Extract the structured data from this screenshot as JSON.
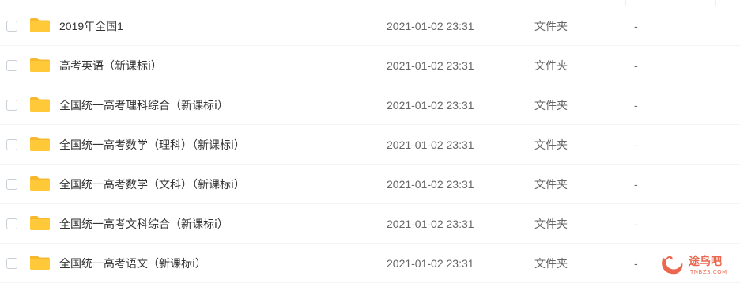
{
  "files": [
    {
      "name": "2019年全国1",
      "date": "2021-01-02 23:31",
      "type": "文件夹",
      "size": "-"
    },
    {
      "name": "高考英语（新课标ⅰ）",
      "date": "2021-01-02 23:31",
      "type": "文件夹",
      "size": "-"
    },
    {
      "name": "全国统一高考理科综合（新课标ⅰ）",
      "date": "2021-01-02 23:31",
      "type": "文件夹",
      "size": "-"
    },
    {
      "name": "全国统一高考数学（理科）（新课标ⅰ）",
      "date": "2021-01-02 23:31",
      "type": "文件夹",
      "size": "-"
    },
    {
      "name": "全国统一高考数学（文科）（新课标ⅰ）",
      "date": "2021-01-02 23:31",
      "type": "文件夹",
      "size": "-"
    },
    {
      "name": "全国统一高考文科综合（新课标ⅰ）",
      "date": "2021-01-02 23:31",
      "type": "文件夹",
      "size": "-"
    },
    {
      "name": "全国统一高考语文（新课标ⅰ）",
      "date": "2021-01-02 23:31",
      "type": "文件夹",
      "size": "-"
    }
  ],
  "icons": {
    "row_icon": "folder-icon",
    "watermark_icon": "swan-logo-icon"
  },
  "colors": {
    "folder": "#ffc93a",
    "folder_tab": "#f5b82e",
    "watermark": "#e8583c"
  },
  "watermark": {
    "text": "途鸟吧",
    "sub": "TNBZS.COM"
  }
}
